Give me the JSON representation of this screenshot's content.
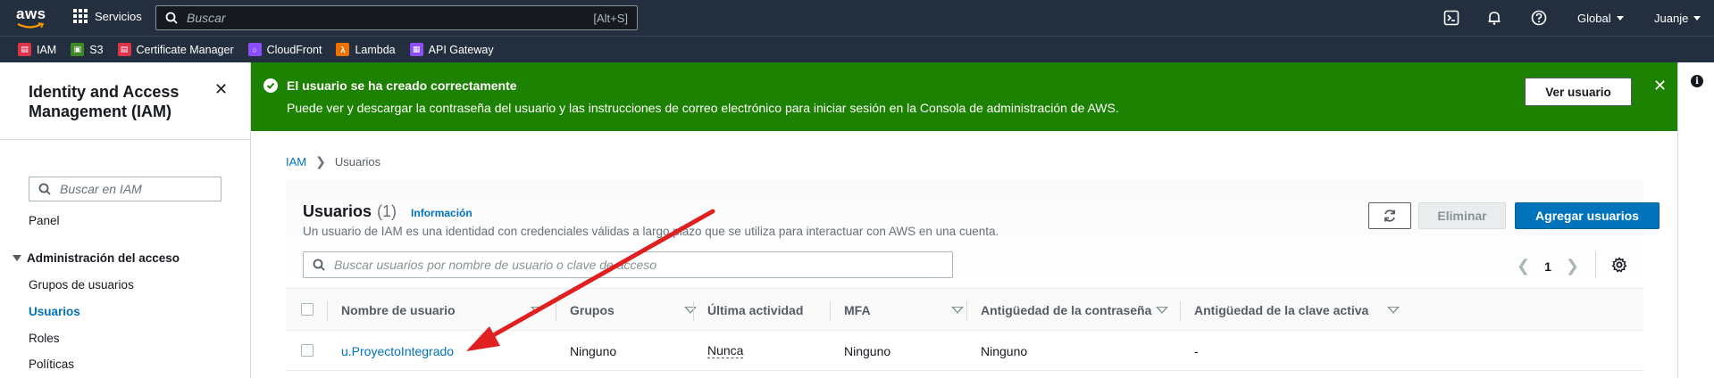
{
  "topnav": {
    "logo_text": "aws",
    "services_label": "Servicios",
    "search_placeholder": "Buscar",
    "search_shortcut": "[Alt+S]",
    "region_label": "Global",
    "user_label": "Juanje"
  },
  "favorites": [
    {
      "label": "IAM",
      "color": "#dd344c"
    },
    {
      "label": "S3",
      "color": "#3f8624"
    },
    {
      "label": "Certificate Manager",
      "color": "#dd344c"
    },
    {
      "label": "CloudFront",
      "color": "#8c4fff"
    },
    {
      "label": "Lambda",
      "color": "#ed7100"
    },
    {
      "label": "API Gateway",
      "color": "#8c4fff"
    }
  ],
  "sidebar": {
    "title": "Identity and Access Management (IAM)",
    "search_placeholder": "Buscar en IAM",
    "panel_link": "Panel",
    "section_title": "Administración del acceso",
    "items": [
      "Grupos de usuarios",
      "Usuarios",
      "Roles",
      "Políticas"
    ]
  },
  "flash": {
    "title": "El usuario se ha creado correctamente",
    "description": "Puede ver y descargar la contraseña del usuario y las instrucciones de correo electrónico para iniciar sesión en la Consola de administración de AWS.",
    "button_label": "Ver usuario",
    "color": "#1d8102"
  },
  "breadcrumb": {
    "root": "IAM",
    "current": "Usuarios"
  },
  "users_panel": {
    "title": "Usuarios",
    "count": "(1)",
    "info_link": "Información",
    "description": "Un usuario de IAM es una identidad con credenciales válidas a largo plazo que se utiliza para interactuar con AWS en una cuenta.",
    "delete_label": "Eliminar",
    "add_label": "Agregar usuarios",
    "search_placeholder": "Buscar usuarios por nombre de usuario o clave de acceso",
    "page_number": "1"
  },
  "table": {
    "columns": [
      "Nombre de usuario",
      "Grupos",
      "Última actividad",
      "MFA",
      "Antigüedad de la contraseña",
      "Antigüedad de la clave activa"
    ],
    "rows": [
      [
        "u.ProyectoIntegrado",
        "Ninguno",
        "Nunca",
        "Ninguno",
        "Ninguno",
        "-"
      ]
    ]
  },
  "colors": {
    "nav_bg": "#232f3e",
    "primary": "#0073bb",
    "annotation_arrow": "#e02020"
  }
}
